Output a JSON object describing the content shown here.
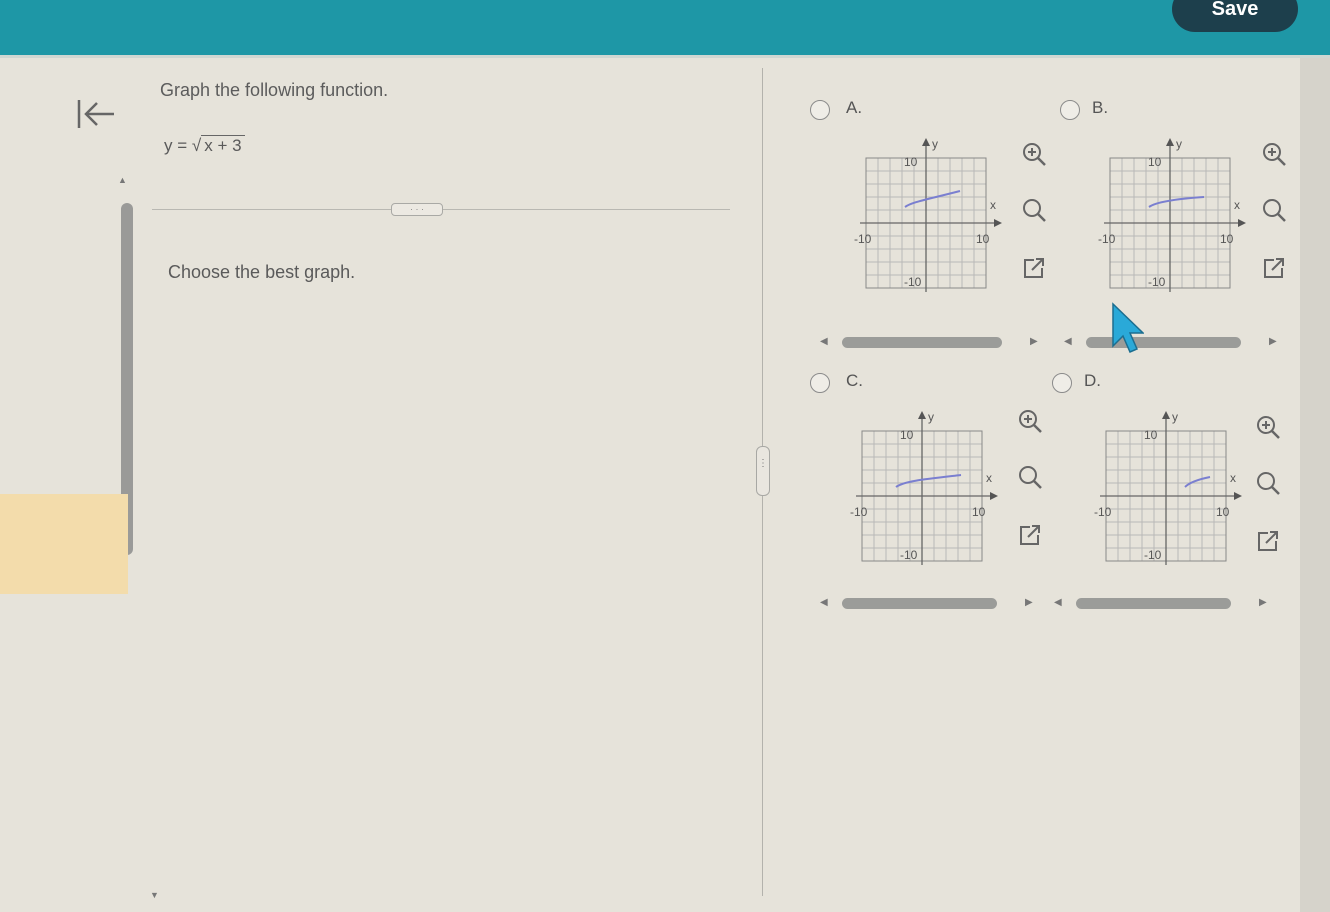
{
  "header": {
    "save_label": "Save"
  },
  "question": {
    "instruction": "Graph the following function.",
    "equation_prefix": "y = ",
    "equation_radicand": "x + 3",
    "expand_label": "· · ·",
    "prompt": "Choose the best graph."
  },
  "options": [
    {
      "letter": "A.",
      "y_top_label": "10",
      "y_bottom_label": "-10",
      "x_left_label": "-10",
      "x_right_label": "10",
      "x_axis": "x",
      "y_axis": "y"
    },
    {
      "letter": "B.",
      "y_top_label": "10",
      "y_bottom_label": "-10",
      "x_left_label": "-10",
      "x_right_label": "10",
      "x_axis": "x",
      "y_axis": "y"
    },
    {
      "letter": "C.",
      "y_top_label": "10",
      "y_bottom_label": "-10",
      "x_left_label": "-10",
      "x_right_label": "10",
      "x_axis": "x",
      "y_axis": "y"
    },
    {
      "letter": "D.",
      "y_top_label": "10",
      "y_bottom_label": "-10",
      "x_left_label": "-10",
      "x_right_label": "10",
      "x_axis": "x",
      "y_axis": "y"
    }
  ],
  "icons": {
    "back": "back-to-start-icon",
    "zoom_in": "zoom-in-icon",
    "zoom_out": "zoom-out-icon",
    "popout": "popout-icon"
  },
  "colors": {
    "header": "#1e97a6",
    "save_button": "#1d3f4c",
    "curve": "#7a7fd0",
    "grid": "#b8b8b8"
  }
}
